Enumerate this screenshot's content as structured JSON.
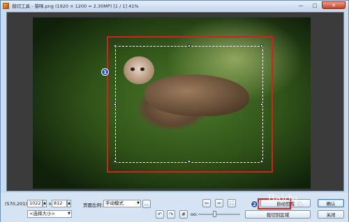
{
  "window": {
    "title": "裁切工具 - 猫咪.png (1920 × 1200 = 2.30MP) [1 / 1] 41%",
    "controls": {
      "minimize": "—",
      "maximize": "□",
      "close": "✕"
    }
  },
  "toolbar": {
    "coordinates": "(570,201)",
    "width_value": "1022",
    "height_value": "812",
    "size_separator": "×",
    "size_preset": "<选择大小>",
    "ratio_label": "页面比例：",
    "ratio_value": "手动模式",
    "ratio_more": "...",
    "auto_adjust_button": "自动剪裁",
    "fit_button": "裁切到区域",
    "ok_button": "确认",
    "close_button": "关闭",
    "zoom_label": "oo:"
  },
  "annotations": {
    "badge_1": "1",
    "badge_2": "2"
  },
  "icons": {
    "app": "app-icon",
    "rotate_left": "↶",
    "rotate_right": "↷",
    "grid": "#",
    "prev": "⇦",
    "next": "⇨",
    "fullscreen": "⛶",
    "spin_up": "▲",
    "spin_down": "▼",
    "dropdown": "▼",
    "cursor": "⬉"
  },
  "watermark": "Baidu"
}
